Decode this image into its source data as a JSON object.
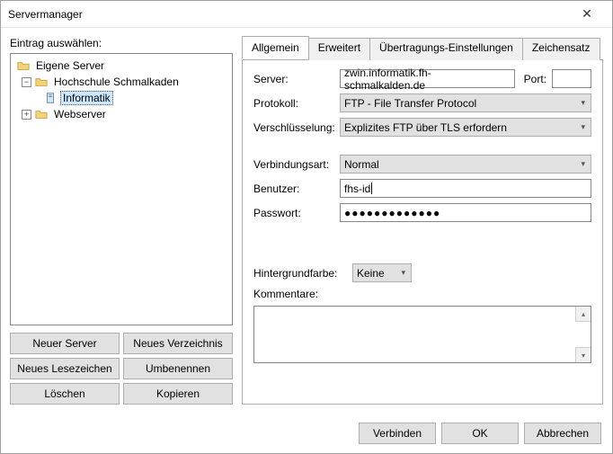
{
  "window": {
    "title": "Servermanager"
  },
  "left": {
    "label": "Eintrag auswählen:",
    "tree": {
      "root": "Eigene Server",
      "hs": "Hochschule Schmalkaden",
      "informatik": "Informatik",
      "webserver": "Webserver"
    },
    "buttons": {
      "new_server": "Neuer Server",
      "new_dir": "Neues Verzeichnis",
      "new_bookmark": "Neues Lesezeichen",
      "rename": "Umbenennen",
      "delete": "Löschen",
      "copy": "Kopieren"
    }
  },
  "tabs": {
    "general": "Allgemein",
    "advanced": "Erweitert",
    "transfer": "Übertragungs-Einstellungen",
    "charset": "Zeichensatz"
  },
  "form": {
    "server_label": "Server:",
    "server_value": "zwin.informatik.fh-schmalkalden.de",
    "port_label": "Port:",
    "port_value": "",
    "protocol_label": "Protokoll:",
    "protocol_value": "FTP - File Transfer Protocol",
    "encryption_label": "Verschlüsselung:",
    "encryption_value": "Explizites FTP über TLS erfordern",
    "conntype_label": "Verbindungsart:",
    "conntype_value": "Normal",
    "user_label": "Benutzer:",
    "user_value": "fhs-id",
    "password_label": "Passwort:",
    "password_value": "●●●●●●●●●●●●●",
    "bgcolor_label": "Hintergrundfarbe:",
    "bgcolor_value": "Keine",
    "comments_label": "Kommentare:"
  },
  "footer": {
    "connect": "Verbinden",
    "ok": "OK",
    "cancel": "Abbrechen"
  }
}
